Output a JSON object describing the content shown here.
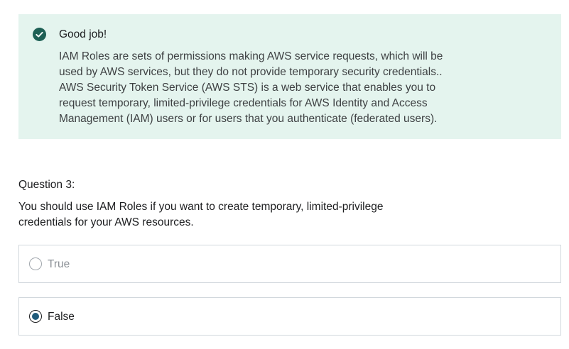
{
  "feedback": {
    "icon": "check-circle-icon",
    "accent_color": "#1e6055",
    "background_color": "#e4f4ee",
    "title": "Good job!",
    "explanation_lines": [
      "IAM Roles are sets of permissions making AWS service requests, which will be",
      "used by AWS services, but they do not provide temporary security credentials..",
      "AWS Security Token Service (AWS STS) is a web service that enables you to",
      "request temporary, limited-privilege credentials for AWS Identity and Access",
      "Management (IAM) users or for users that you authenticate (federated users)."
    ]
  },
  "question": {
    "label": "Question 3:",
    "text_lines": [
      "You should use IAM Roles if you want to create temporary, limited-privilege",
      "credentials for your AWS resources."
    ],
    "options": [
      {
        "label": "True",
        "selected": false
      },
      {
        "label": "False",
        "selected": true
      }
    ]
  }
}
